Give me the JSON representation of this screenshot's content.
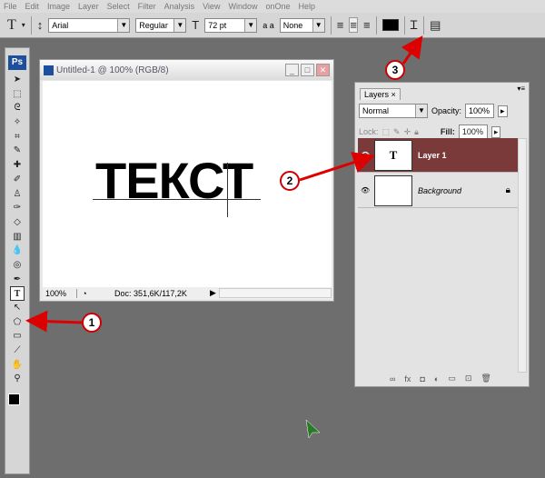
{
  "menu": [
    "File",
    "Edit",
    "Image",
    "Layer",
    "Select",
    "Filter",
    "Analysis",
    "View",
    "Window",
    "onOne",
    "Help"
  ],
  "options": {
    "tool_icon": "T",
    "font_family": "Arial",
    "font_style": "Regular",
    "font_size": "72 pt",
    "aa_label": "a a",
    "antialias": "None",
    "color": "#000000"
  },
  "toolbox": {
    "logo": "Ps",
    "tools": [
      "move",
      "marquee",
      "lasso",
      "magic-wand",
      "crop",
      "slice",
      "healing",
      "brush",
      "stamp",
      "history-brush",
      "eraser",
      "gradient",
      "blur",
      "dodge",
      "pen",
      "T",
      "path-select",
      "shape",
      "notes",
      "eyedropper",
      "hand",
      "zoom"
    ]
  },
  "document": {
    "title": "Untitled-1 @ 100% (RGB/8)",
    "text": "ТЕКСТ",
    "zoom": "100%",
    "doc_info": "Doc: 351,6K/117,2K"
  },
  "layers_panel": {
    "tab": "Layers",
    "blend_mode": "Normal",
    "opacity_label": "Opacity:",
    "opacity": "100%",
    "lock_label": "Lock:",
    "fill_label": "Fill:",
    "fill": "100%",
    "layers": [
      {
        "name": "Layer 1",
        "thumb": "T",
        "selected": true
      },
      {
        "name": "Background",
        "thumb": "",
        "locked": true
      }
    ],
    "selected_color": "#7a3a3a"
  },
  "callouts": [
    "1",
    "2",
    "3"
  ]
}
